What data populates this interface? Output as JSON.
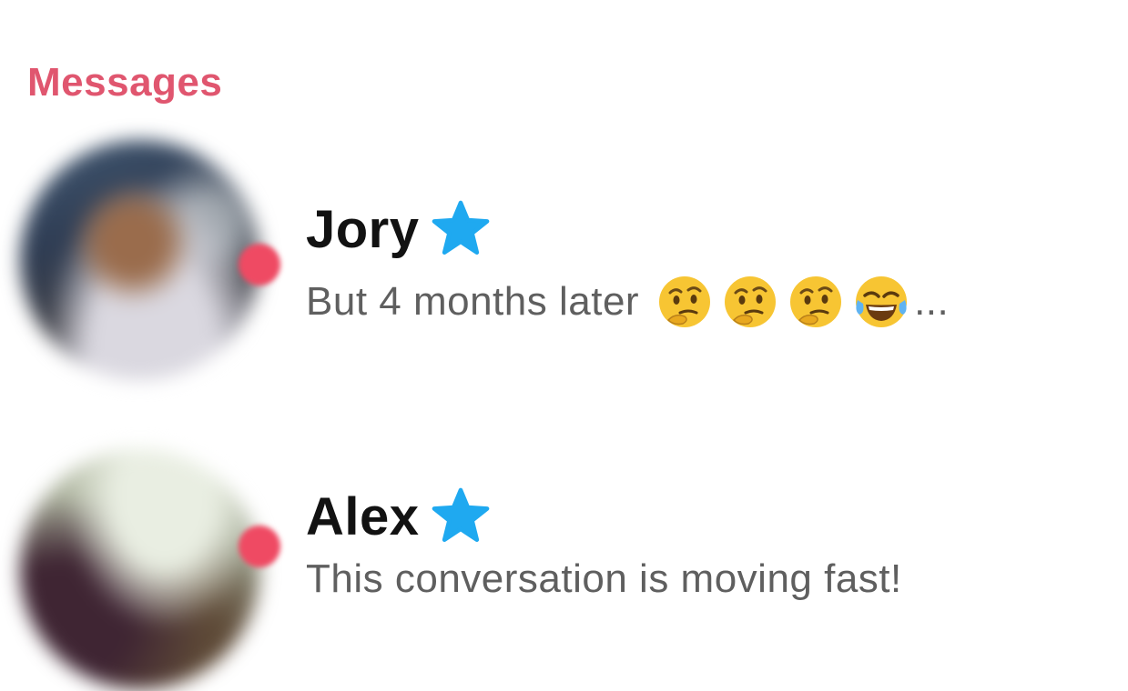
{
  "section": {
    "title": "Messages"
  },
  "conversations": [
    {
      "name": "Jory",
      "badge": "star-icon",
      "preview": "But 4 months later",
      "emojis": [
        "thinking-face-icon",
        "thinking-face-icon",
        "thinking-face-icon",
        "tears-of-joy-icon"
      ],
      "suffix": "...",
      "unread": true
    },
    {
      "name": "Alex",
      "badge": "star-icon",
      "preview": "This conversation is moving fast!",
      "unread": true
    }
  ],
  "colors": {
    "accent": "#e0566f",
    "unread_dot": "#ef4a63",
    "star": "#1fa9f0",
    "name": "#121212",
    "preview": "#5f5f5f"
  }
}
